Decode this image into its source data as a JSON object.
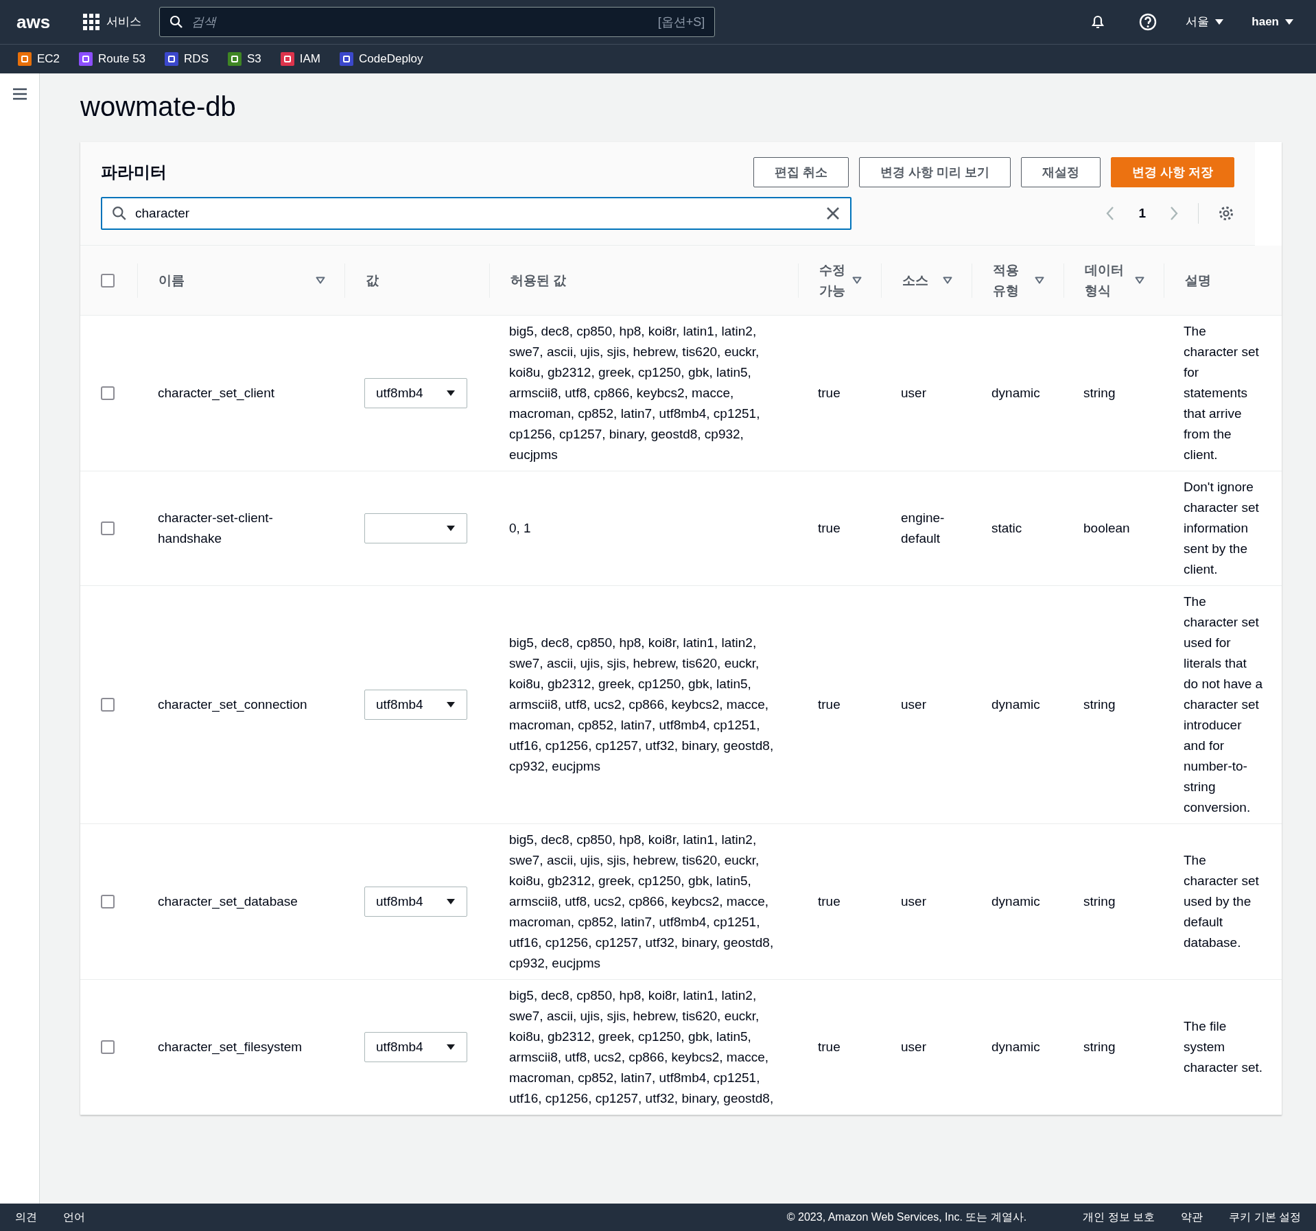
{
  "topbar": {
    "logo": "aws",
    "services": "서비스",
    "search_placeholder": "검색",
    "search_shortcut": "[옵션+S]",
    "region": "서울",
    "user": "haen"
  },
  "favorites": [
    {
      "label": "EC2",
      "color": "#e8700a"
    },
    {
      "label": "Route 53",
      "color": "#8c4fff"
    },
    {
      "label": "RDS",
      "color": "#3b48cc"
    },
    {
      "label": "S3",
      "color": "#3f8624"
    },
    {
      "label": "IAM",
      "color": "#dd344c"
    },
    {
      "label": "CodeDeploy",
      "color": "#3b48cc"
    }
  ],
  "page_title": "wowmate-db",
  "panel": {
    "title": "파라미터",
    "buttons": [
      {
        "label": "편집 취소",
        "kind": "normal"
      },
      {
        "label": "변경 사항 미리 보기",
        "kind": "normal"
      },
      {
        "label": "재설정",
        "kind": "normal"
      },
      {
        "label": "변경 사항 저장",
        "kind": "primary"
      }
    ],
    "filter_value": "character",
    "page": "1"
  },
  "table": {
    "select_all": false,
    "columns": [
      {
        "label": "이름",
        "sortable": true
      },
      {
        "label": "값",
        "sortable": false
      },
      {
        "label": "허용된 값",
        "sortable": false
      },
      {
        "label": "수정 가능",
        "sortable": true
      },
      {
        "label": "소스",
        "sortable": true
      },
      {
        "label": "적용 유형",
        "sortable": true
      },
      {
        "label": "데이터 형식",
        "sortable": true
      },
      {
        "label": "설명",
        "sortable": false
      }
    ],
    "rows": [
      {
        "checked": false,
        "name": "character_set_client",
        "value": "utf8mb4",
        "allowed": "big5, dec8, cp850, hp8, koi8r, latin1, latin2, swe7, ascii, ujis, sjis, hebrew, tis620, euckr, koi8u, gb2312, greek, cp1250, gbk, latin5, armscii8, utf8, cp866, keybcs2, macce, macroman, cp852, latin7, utf8mb4, cp1251, cp1256, cp1257, binary, geostd8, cp932, eucjpms",
        "editable": "true",
        "source": "user",
        "apply_type": "dynamic",
        "data_type": "string",
        "description": "The character set for statements that arrive from the client."
      },
      {
        "checked": false,
        "name": "character-set-client-handshake",
        "value": "",
        "allowed": "0, 1",
        "editable": "true",
        "source": "engine-default",
        "apply_type": "static",
        "data_type": "boolean",
        "description": "Don't ignore character set information sent by the client."
      },
      {
        "checked": false,
        "name": "character_set_connection",
        "value": "utf8mb4",
        "allowed": "big5, dec8, cp850, hp8, koi8r, latin1, latin2, swe7, ascii, ujis, sjis, hebrew, tis620, euckr, koi8u, gb2312, greek, cp1250, gbk, latin5, armscii8, utf8, ucs2, cp866, keybcs2, macce, macroman, cp852, latin7, utf8mb4, cp1251, utf16, cp1256, cp1257, utf32, binary, geostd8, cp932, eucjpms",
        "editable": "true",
        "source": "user",
        "apply_type": "dynamic",
        "data_type": "string",
        "description": "The character set used for literals that do not have a character set introducer and for number-to-string conversion."
      },
      {
        "checked": false,
        "name": "character_set_database",
        "value": "utf8mb4",
        "allowed": "big5, dec8, cp850, hp8, koi8r, latin1, latin2, swe7, ascii, ujis, sjis, hebrew, tis620, euckr, koi8u, gb2312, greek, cp1250, gbk, latin5, armscii8, utf8, ucs2, cp866, keybcs2, macce, macroman, cp852, latin7, utf8mb4, cp1251, utf16, cp1256, cp1257, utf32, binary, geostd8, cp932, eucjpms",
        "editable": "true",
        "source": "user",
        "apply_type": "dynamic",
        "data_type": "string",
        "description": "The character set used by the default database."
      },
      {
        "checked": false,
        "name": "character_set_filesystem",
        "value": "utf8mb4",
        "allowed": "big5, dec8, cp850, hp8, koi8r, latin1, latin2, swe7, ascii, ujis, sjis, hebrew, tis620, euckr, koi8u, gb2312, greek, cp1250, gbk, latin5, armscii8, utf8, ucs2, cp866, keybcs2, macce, macroman, cp852, latin7, utf8mb4, cp1251, utf16, cp1256, cp1257, utf32, binary, geostd8,",
        "editable": "true",
        "source": "user",
        "apply_type": "dynamic",
        "data_type": "string",
        "description": "The file system character set."
      }
    ]
  },
  "footer": {
    "left": [
      "의견",
      "언어"
    ],
    "copyright": "© 2023, Amazon Web Services, Inc. 또는 계열사.",
    "links": [
      "개인 정보 보호",
      "약관",
      "쿠키 기본 설정"
    ]
  }
}
